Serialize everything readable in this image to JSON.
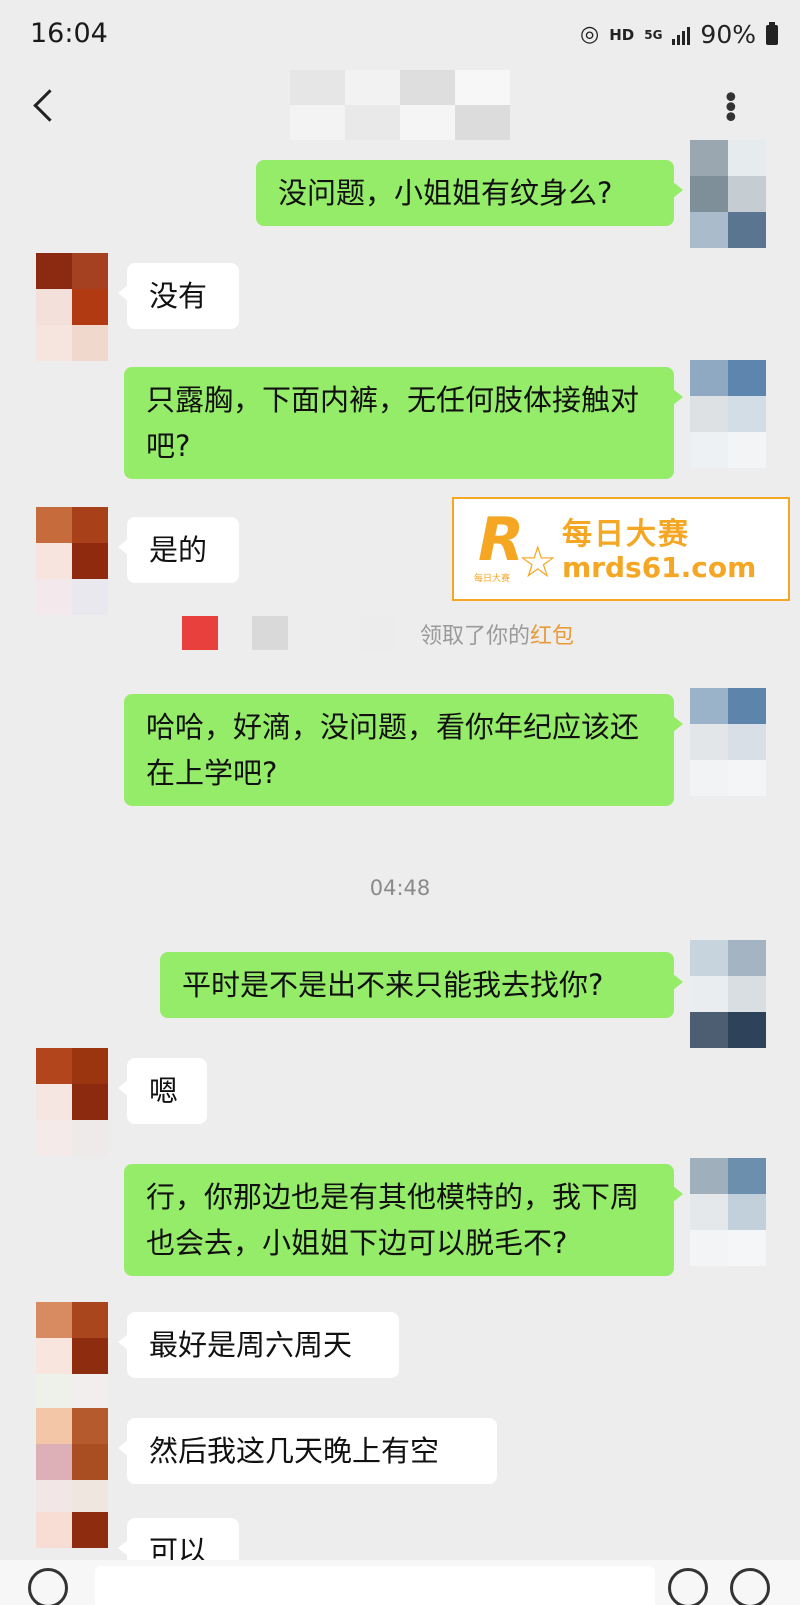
{
  "status_bar": {
    "time": "16:04",
    "network": "HD",
    "network_type": "5G",
    "battery": "90%"
  },
  "nav": {
    "back_icon": "chevron-left-icon",
    "more_icon": "ellipsis-icon"
  },
  "messages": [
    {
      "side": "mine",
      "text": "没问题，小姐姐有纹身么?"
    },
    {
      "side": "theirs",
      "text": "没有"
    },
    {
      "side": "mine",
      "text": "只露胸，下面内裤，无任何肢体接触对吧?"
    },
    {
      "side": "theirs",
      "text": "是的"
    },
    {
      "side": "mine",
      "text": "哈哈，好滴，没问题，看你年纪应该还在上学吧?"
    },
    {
      "side": "mine",
      "text": "平时是不是出不来只能我去找你?"
    },
    {
      "side": "theirs",
      "text": "嗯"
    },
    {
      "side": "mine",
      "text": "行，你那边也是有其他模特的，我下周也会去，小姐姐下边可以脱毛不?"
    },
    {
      "side": "theirs",
      "text": "最好是周六周天"
    },
    {
      "side": "theirs",
      "text": "然后我这几天晚上有空"
    },
    {
      "side": "theirs",
      "text": "可以"
    }
  ],
  "system_message": {
    "text": "领取了你的",
    "link": "红包"
  },
  "time_divider": "04:48",
  "watermark": {
    "title": "每日大赛",
    "site": "mrds61.com",
    "logo_small": "每日大赛"
  },
  "colors": {
    "mine_bubble": "#95ec69",
    "theirs_bubble": "#ffffff",
    "background": "#ededed",
    "watermark_accent": "#f5a623"
  }
}
